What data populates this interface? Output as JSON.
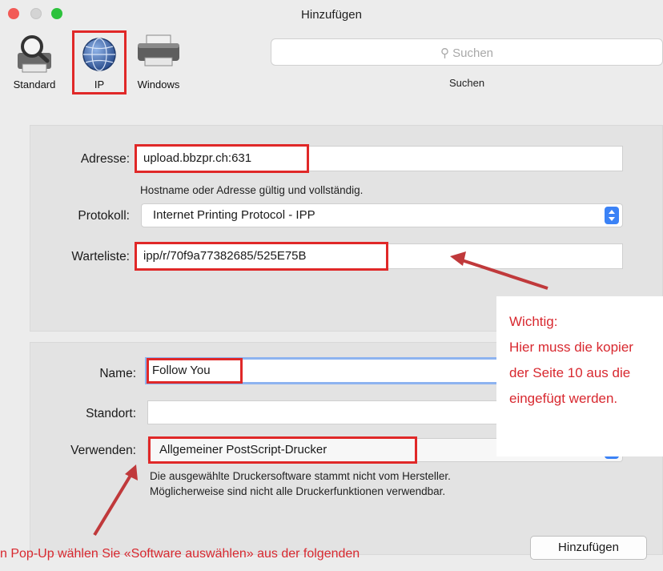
{
  "window": {
    "title": "Hinzufügen"
  },
  "toolbar": {
    "standard_label": "Standard",
    "ip_label": "IP",
    "windows_label": "Windows",
    "search_placeholder": "Suchen",
    "search_label": "Suchen"
  },
  "connection": {
    "address_label": "Adresse:",
    "address_value": "upload.bbzpr.ch:631",
    "address_hint": "Hostname oder Adresse gültig und vollständig.",
    "protocol_label": "Protokoll:",
    "protocol_value": "Internet Printing Protocol - IPP",
    "queue_label": "Warteliste:",
    "queue_value": "ipp/r/70f9a77382685/525E75B"
  },
  "printer": {
    "name_label": "Name:",
    "name_value": "Follow You",
    "location_label": "Standort:",
    "location_value": "",
    "use_label": "Verwenden:",
    "use_value": "Allgemeiner PostScript-Drucker",
    "driver_hint_1": "Die ausgewählte Druckersoftware stammt nicht vom Hersteller.",
    "driver_hint_2": "Möglicherweise sind nicht alle Druckerfunktionen verwendbar."
  },
  "annotation": {
    "line1": "Wichtig:",
    "line2": "Hier muss die kopier",
    "line3": "der Seite 10 aus die",
    "line4": "eingefügt werden.",
    "bottom_text": "n Pop-Up wählen Sie «Software auswählen» aus der folgenden",
    "color": "#d8282f"
  },
  "actions": {
    "add_label": "Hinzufügen"
  }
}
